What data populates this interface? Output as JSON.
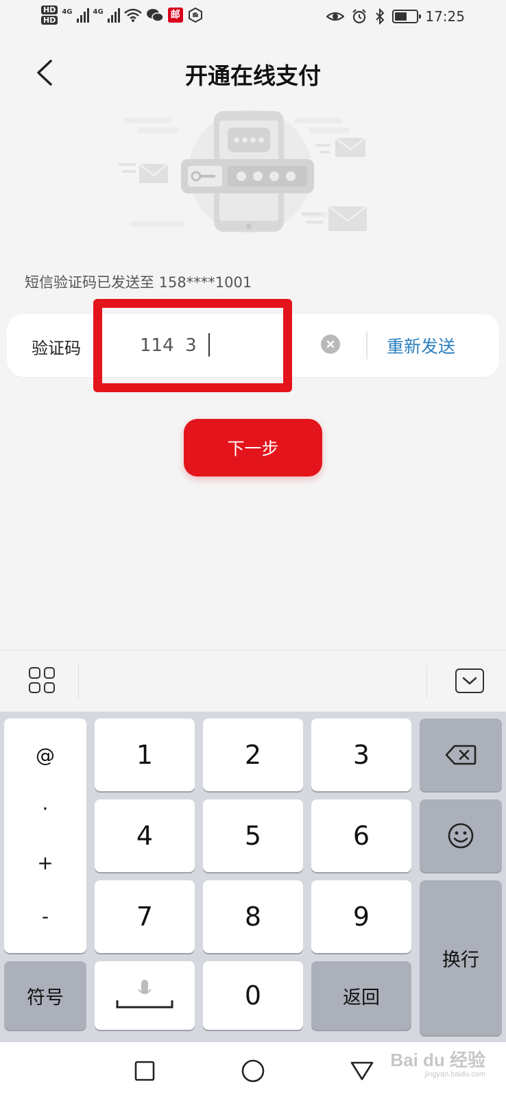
{
  "status_bar": {
    "hd_labels": [
      "HD",
      "HD"
    ],
    "network": [
      "4G",
      "4G"
    ],
    "mail_badge": "邮",
    "time": "17:25"
  },
  "header": {
    "title": "开通在线支付"
  },
  "verification": {
    "hint": "短信验证码已发送至 158****1001",
    "label": "验证码",
    "value": "114  3",
    "resend_label": "重新发送"
  },
  "next_button": "下一步",
  "keyboard": {
    "symbols": [
      "@",
      "·",
      "+",
      "-"
    ],
    "keys": [
      "1",
      "2",
      "3",
      "4",
      "5",
      "6",
      "7",
      "8",
      "9",
      "0"
    ],
    "symbol_key": "符号",
    "return_key": "返回",
    "newline_key": "换行"
  },
  "watermark": {
    "brand": "Bai du 经验",
    "url": "jingyan.baidu.com"
  },
  "colors": {
    "accent": "#e3141c",
    "link": "#2a7fc1",
    "highlight": "#e3141c"
  }
}
